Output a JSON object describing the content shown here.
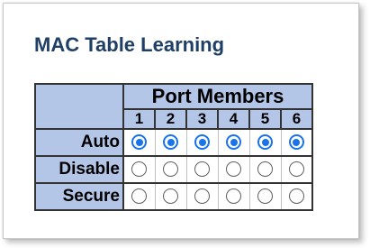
{
  "section": {
    "title": "MAC Table Learning"
  },
  "table": {
    "group_header": "Port Members",
    "ports": [
      "1",
      "2",
      "3",
      "4",
      "5",
      "6"
    ],
    "rows": [
      {
        "label": "Auto",
        "selected": [
          true,
          true,
          true,
          true,
          true,
          true
        ]
      },
      {
        "label": "Disable",
        "selected": [
          false,
          false,
          false,
          false,
          false,
          false
        ]
      },
      {
        "label": "Secure",
        "selected": [
          false,
          false,
          false,
          false,
          false,
          false
        ]
      }
    ]
  },
  "colors": {
    "header_bg": "#b4c6e7",
    "title": "#1f3f66",
    "radio_checked": "#1a73e8",
    "border": "#333333"
  }
}
